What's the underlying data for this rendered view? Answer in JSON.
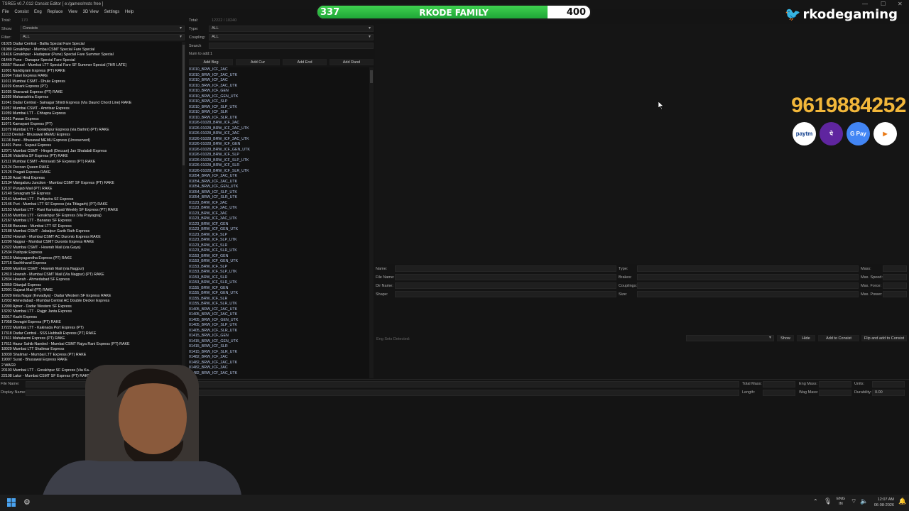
{
  "window": {
    "title": "TSRE5 v0.7.012 Consist Editor  [ e:/games/msts free ]",
    "minimize": "—",
    "maximize": "☐",
    "close": "✕"
  },
  "menu": [
    "File",
    "Consist",
    "Eng",
    "Replace",
    "View",
    "3D View",
    "Settings",
    "Help"
  ],
  "left": {
    "total_label": "Total:",
    "total_value": "170",
    "show_label": "Show:",
    "show_value": "Consists",
    "filter_label": "Filter:",
    "filter_value": "ALL",
    "consists": [
      "01025 Dadar Central - Ballia Special Fare Special",
      "01080 Gorakhpur - Mumbai CSMT Special Fare Special",
      "01416 Gorakhpur - Hadapsar (Pune) Special Fare Summer Special",
      "01449 Pune - Danapur Special Fare Special",
      "05557 Raxaul - Mumbai LTT Special Fare SF Summer Special (7HR LATE)",
      "11001 Nandigram Express (PT) RAKE",
      "11004 Tutari Express RAKE",
      "11011 Mumbai CSMT - Dhule Express",
      "11019 Konark Express (PT)",
      "11035 Sharavati Express (PT) RAKE",
      "11039 Maharashtra Express",
      "11041 Dadar Central - Sainagar Shirdi Express (Via Daund Chord Line) RAKE",
      "11057 Mumbai CSMT - Amritsar Express",
      "11059 Mumbai LTT - Chhapra Express",
      "11061 Pawan Express",
      "11071 Kamayani Express (PT)",
      "11079 Mumbai LTT - Gorakhpur Express (via Barhni) (PT) RAKE",
      "11113 Devlali - Bhusawal MEMU Express",
      "11116 Itarsi - Bhusawal MEMU Express (Unreserved)",
      "11401 Pune - Supaul Express",
      "12071 Mumbai CSMT - Hingoli (Deccan) Jan Shatabdi Express",
      "12106 Vidarbha SF Express (PT) RAKE",
      "12111 Mumbai CSMT - Amravati SF Express (PT) RAKE",
      "12124 Deccan Queen RAKE",
      "12126 Pragati Express RAKE",
      "12130 Azad Hind Express",
      "12134 Mangaluru Junction - Mumbai CSMT SF Express (PT) RAKE",
      "12137 Punjab Mail (PT) RAKE",
      "12140 Sevagram SF Express",
      "12141 Mumbai LTT - Patliputra SF Express",
      "12146 Puri - Mumbai LTT SF Express (via Titlagarh) (PT) RAKE",
      "12153 Mumbai LTT - Rani Kamalapati Weekly SF Express (PT) RAKE",
      "12165 Mumbai LTT - Gorakhpur SF Express (Via Prayagraj)",
      "12167 Mumbai LTT - Banaras SF Express",
      "12168 Banaras - Mumbai LTT SF Express",
      "12188 Mumbai CSMT - Jabalpur Garib Rath Express",
      "12262 Howrah - Mumbai CSMT AC Duronto Express RAKE",
      "12290 Nagpur - Mumbai CSMT Duronto Express RAKE",
      "12322 Mumbai CSMT - Howrah Mail (via Gaya)",
      "12534 Pushpak Express",
      "12619 Matsyagandha Express (PT) RAKE",
      "12716 Sachkhand Express",
      "12809 Mumbai CSMT - Howrah Mail (via Nagpur)",
      "12810 Howrah - Mumbai CSMT Mail (Via Nagpur) (PT) RAKE",
      "12834 Howrah - Ahmedabad SF Express",
      "12859 Gitanjali Express",
      "12901 Gujarat Mail (PT) RAKE",
      "12929 Ekta Nagar (Kevadiya) - Dadar Western SF Express RAKE",
      "12932 Ahmedabad - Mumbai Central AC Double Decker Express",
      "12990 Ajmer - Dadar Western SF Express",
      "13202 Mumbai LTT - Rajgir Janta Express",
      "15017 Kashi Express",
      "17058 Devagiri Express (PT) RAKE",
      "17222 Mumbai LTT - Kakinada Port Express (PT)",
      "17318 Dadar Central - SSS Hubballi Express (PT) RAKE",
      "17411 Mahalaxmi Express (PT) RAKE",
      "17611 Hazur Sahib Nanded - Mumbai CSMT Rajya Rani Express (PT) RAKE",
      "18029 Mumbai LTT Shalimar Express",
      "18030 Shalimar - Mumbai LTT Express (PT) RAKE",
      "19007 Surat - Bhusawal Express RAKE",
      "2 WAG9",
      "20103 Mumbai LTT - Gorakhpur SF Express (Via Ka...",
      "22108 Latur - Mumbai CSMT SF Express (PT) RAKE"
    ]
  },
  "middle": {
    "total_label": "Total:",
    "total_value": "12222 / 10240",
    "type_label": "Type:",
    "type_value": "ALL",
    "coupling_label": "Coupling:",
    "coupling_value": "ALL",
    "search_label": "Search",
    "num_label": "Num to add:",
    "num_value": "1",
    "buttons": [
      "Add Beg",
      "Add Cur",
      "Add End",
      "Add Rand"
    ],
    "wagons": [
      "01010_BRW_ICF_2AC",
      "01010_BRW_ICF_2AC_UTK",
      "01010_BRW_ICF_3AC",
      "01010_BRW_ICF_3AC_UTK",
      "01010_BRW_ICF_GEN",
      "01010_BRW_ICF_GEN_UTK",
      "01010_BRW_ICF_SLP",
      "01010_BRW_ICF_SLP_UTK",
      "01010_BRW_ICF_SLR",
      "01010_BRW_ICF_SLR_UTK",
      "01026-01028_BRW_ICF_2AC",
      "01026-01028_BRW_ICF_2AC_UTK",
      "01026-01028_BRW_ICF_3AC",
      "01026-01028_BRW_ICF_3AC_UTK",
      "01026-01028_BRW_ICF_GEN",
      "01026-01028_BRW_ICF_GEN_UTK",
      "01026-01028_BRW_ICF_SLP",
      "01026-01028_BRW_ICF_SLP_UTK",
      "01026-01028_BRW_ICF_SLR",
      "01026-01028_BRW_ICF_SLR_UTK",
      "01054_BRW_ICF_2AC_UTK",
      "01054_BRW_ICF_3AC_UTK",
      "01054_BRW_ICF_GEN_UTK",
      "01054_BRW_ICF_SLP_UTK",
      "01054_BRW_ICF_SLR_UTK",
      "01123_BRW_ICF_2AC",
      "01123_BRW_ICF_2AC_UTK",
      "01123_BRW_ICF_3AC",
      "01123_BRW_ICF_3AC_UTK",
      "01123_BRW_ICF_GEN",
      "01123_BRW_ICF_GEN_UTK",
      "01123_BRW_ICF_SLP",
      "01123_BRW_ICF_SLP_UTK",
      "01123_BRW_ICF_SLR",
      "01123_BRW_ICF_SLR_UTK",
      "01153_BRW_ICF_GEN",
      "01153_BRW_ICF_GEN_UTK",
      "01153_BRW_ICF_SLP",
      "01153_BRW_ICF_SLP_UTK",
      "01153_BRW_ICF_SLR",
      "01153_BRW_ICF_SLR_UTK",
      "01155_BRW_ICF_GEN",
      "01155_BRW_ICF_GEN_UTK",
      "01155_BRW_ICF_SLR",
      "01155_BRW_ICF_SLR_UTK",
      "01405_BRW_ICF_2AC_UTK",
      "01405_BRW_ICF_3AC_UTK",
      "01405_BRW_ICF_GEN_UTK",
      "01405_BRW_ICF_SLP_UTK",
      "01405_BRW_ICF_SLR_UTK",
      "01415_BRW_ICF_GEN",
      "01415_BRW_ICF_GEN_UTK",
      "01415_BRW_ICF_SLR",
      "01415_BRW_ICF_SLR_UTK",
      "01482_BRW_ICF_2AC",
      "01482_BRW_ICF_2AC_UTK",
      "01482_BRW_ICF_3AC",
      "01482_BRW_ICF_3AC_UTK"
    ]
  },
  "props": {
    "name_label": "Name:",
    "filename_label": "File Name:",
    "dirname_label": "Dir Name:",
    "shape_label": "Shape:",
    "type_label": "Type:",
    "brakes_label": "Brakes:",
    "couplings_label": "Couplings:",
    "size_label": "Size:",
    "mass_label": "Mass:",
    "maxspeed_label": "Max. Speed:",
    "maxforce_label": "Max. Force:",
    "maxpower_label": "Max. Power:",
    "engsets_label": "Eng Sets Detected:",
    "show_btn": "Show",
    "hide_btn": "Hide",
    "addconsist_btn": "Add to Consist",
    "flip_btn": "Flip and add to Consist"
  },
  "bottom": {
    "filename_label": "File Name:",
    "displayname_label": "Display Name:",
    "totalmass_label": "Total Mass:",
    "length_label": "Length:",
    "engmass_label": "Eng Mass:",
    "wagmass_label": "Wag Mass:",
    "units_label": "Units:",
    "durability_label": "Durability:",
    "durability_value": "0.00"
  },
  "overlay": {
    "progress_current": "337",
    "progress_goal": "400",
    "progress_fraction": 0.8425,
    "progress_label": "RKODE FAMILY",
    "channel": "rkodegaming",
    "phone": "9619884252",
    "payments": [
      {
        "name": "paytm",
        "label": "paytm",
        "bg": "#ffffff",
        "fg": "#0b3a8a"
      },
      {
        "name": "phonepe",
        "label": "पे",
        "bg": "#5f259f",
        "fg": "#ffffff"
      },
      {
        "name": "gpay",
        "label": "G Pay",
        "bg": "#4285f4",
        "fg": "#ffffff"
      },
      {
        "name": "bhim",
        "label": "▶",
        "bg": "#ffffff",
        "fg": "#ea7a16"
      }
    ]
  },
  "taskbar": {
    "lang_top": "ENG",
    "lang_bottom": "IN",
    "time": "12:07 AM",
    "date": "06-08-2026"
  },
  "colors": {
    "accent_green": "#2fbf45",
    "phone_yellow": "#f2b73a",
    "brand_white": "#ffffff"
  }
}
